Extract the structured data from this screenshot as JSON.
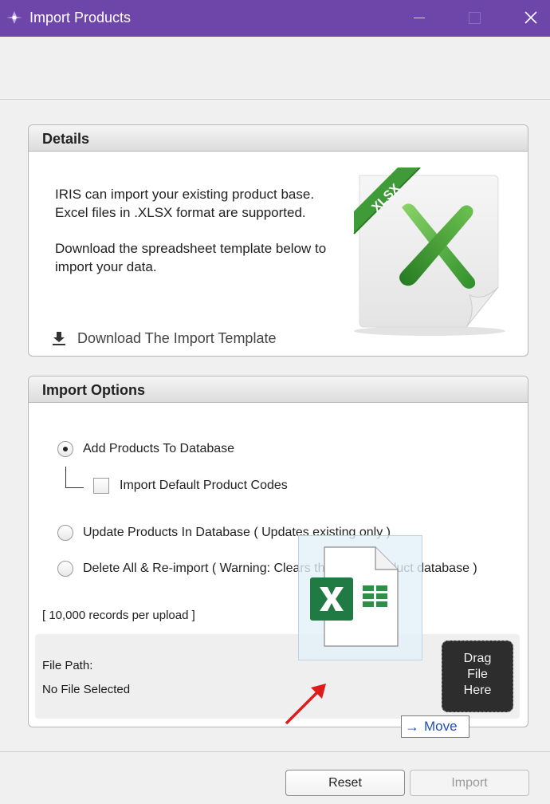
{
  "window": {
    "title": "Import Products",
    "accent_color": "#6e45a8"
  },
  "details": {
    "header": "Details",
    "paragraph1_line1": "IRIS can import your existing product base.",
    "paragraph1_line2": "Excel files in .XLSX format are supported.",
    "paragraph2_line1": "Download the spreadsheet template below to",
    "paragraph2_line2": "import your data.",
    "download_label": "Download The Import Template",
    "file_badge": "XLSX"
  },
  "import_options": {
    "header": "Import Options",
    "options": [
      {
        "label": "Add Products To Database",
        "checked": true
      },
      {
        "label": "Update Products In Database ( Updates existing only )",
        "checked": false
      },
      {
        "label": "Delete All & Re-import ( Warning: Clears the entire product database )",
        "checked": false
      }
    ],
    "sub_option": {
      "label": "Import Default Product Codes",
      "checked": false
    },
    "records_note": "[ 10,000 records per upload ]"
  },
  "file_area": {
    "file_path_label": "File Path:",
    "file_path_value": "No File Selected",
    "drag_line1": "Drag",
    "drag_line2": "File",
    "drag_line3": "Here"
  },
  "drag_overlay": {
    "move_label": "Move"
  },
  "footer": {
    "reset_label": "Reset",
    "import_label": "Import",
    "import_enabled": false
  }
}
